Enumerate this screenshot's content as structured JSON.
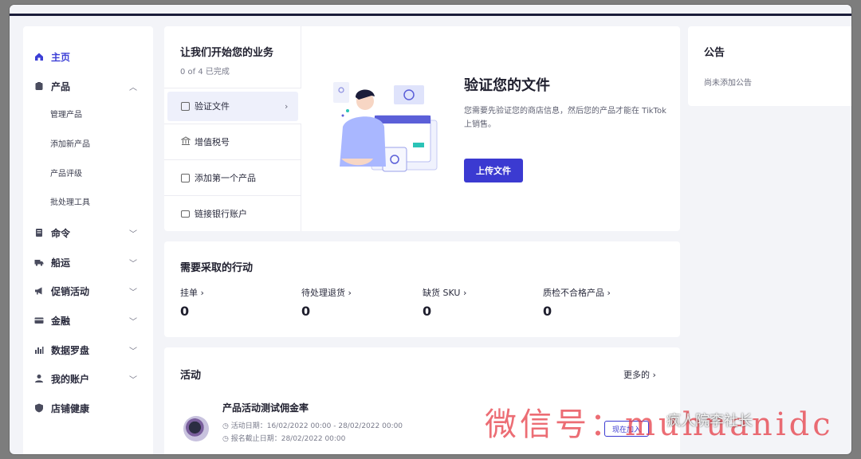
{
  "sidebar": {
    "items": [
      {
        "label": "主页",
        "icon": "home-icon",
        "active": true
      },
      {
        "label": "产品",
        "icon": "product-icon",
        "chevron": "︿"
      },
      {
        "label": "命令",
        "icon": "order-icon",
        "chevron": "﹀"
      },
      {
        "label": "船运",
        "icon": "truck-icon",
        "chevron": "﹀"
      },
      {
        "label": "促销活动",
        "icon": "megaphone-icon",
        "chevron": "﹀"
      },
      {
        "label": "金融",
        "icon": "card-icon",
        "chevron": "﹀"
      },
      {
        "label": "数据罗盘",
        "icon": "chart-icon",
        "chevron": "﹀"
      },
      {
        "label": "我的账户",
        "icon": "user-icon",
        "chevron": "﹀"
      },
      {
        "label": "店铺健康",
        "icon": "shield-icon"
      }
    ],
    "sub_items": [
      "管理产品",
      "添加新产品",
      "产品评级",
      "批处理工具"
    ]
  },
  "setup": {
    "title": "让我们开始您的业务",
    "progress": "0 of 4 已完成",
    "steps": [
      {
        "label": "验证文件",
        "chevron": "›"
      },
      {
        "label": "增值税号"
      },
      {
        "label": "添加第一个产品"
      },
      {
        "label": "链接银行账户"
      }
    ],
    "verify_title": "验证您的文件",
    "verify_desc": "您需要先验证您的商店信息，然后您的产品才能在 TikTok 上销售。",
    "upload_label": "上传文件"
  },
  "notice": {
    "title": "公告",
    "empty": "尚未添加公告"
  },
  "actions": {
    "title": "需要采取的行动",
    "metrics": [
      {
        "label": "挂单 ›",
        "value": "0"
      },
      {
        "label": "待处理退货 ›",
        "value": "0"
      },
      {
        "label": "缺货 SKU ›",
        "value": "0"
      },
      {
        "label": "质检不合格产品 ›",
        "value": "0"
      }
    ]
  },
  "activity": {
    "title": "活动",
    "more": "更多的 ›",
    "name": "产品活动测试佣金率",
    "date": "◷ 活动日期：16/02/2022 00:00 - 28/02/2022 00:00",
    "reg": "◷ 报名截止日期：28/02/2022 00:00",
    "join_label": "现在加入"
  },
  "watermark": {
    "text": "微信号：muhuanidc",
    "account": "疯人院李社长"
  },
  "colors": {
    "accent": "#3b3ad1",
    "nav_active": "#3c3fd6"
  }
}
